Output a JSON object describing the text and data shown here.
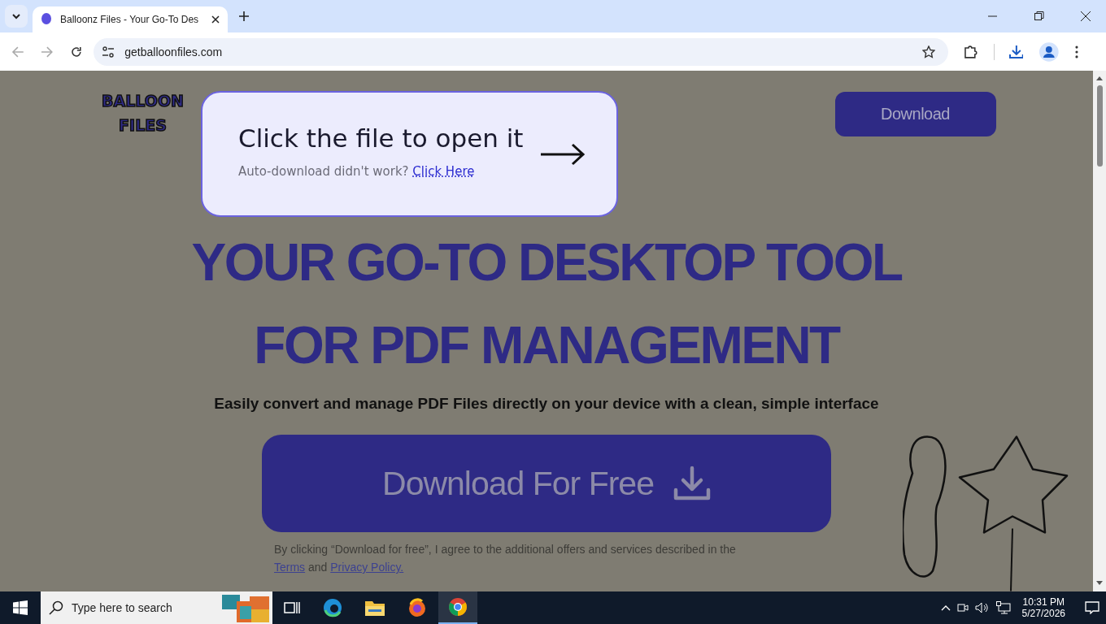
{
  "browser": {
    "tabs": [
      {
        "title": "Balloonz Files - Your Go-To Des",
        "selected": true
      }
    ],
    "url": "getballoonfiles.com"
  },
  "page": {
    "logo": [
      "BALLOON",
      "FILES"
    ],
    "header_button": "Download",
    "headline": [
      "YOUR GO-TO DESKTOP TOOL",
      "FOR PDF MANAGEMENT"
    ],
    "subtitle": "Easily convert and manage PDF Files directly on your device with a clean, simple interface",
    "cta_button": "Download For Free",
    "disclaimer": {
      "text": "By clicking “Download for free”, I agree to the additional offers and services described in the",
      "terms_link": "Terms",
      "joiner": "and",
      "privacy_link": "Privacy Policy."
    }
  },
  "popup": {
    "title": "Click the file to open it",
    "note": "Auto-download didn't work?",
    "link": "Click Here"
  },
  "taskbar": {
    "search": {
      "placeholder": "Type here to search"
    },
    "time": "10:31 PM",
    "date": "5/27/2026"
  }
}
